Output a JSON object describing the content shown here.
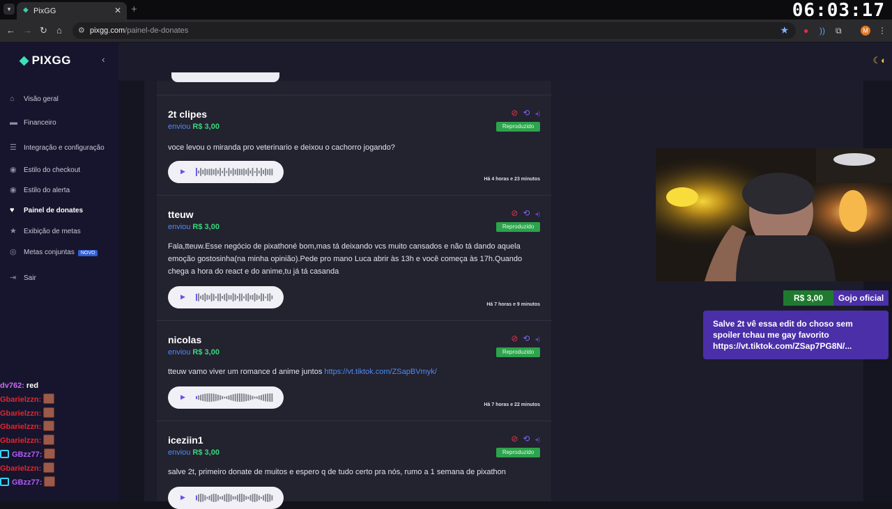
{
  "browser": {
    "tab_title": "PixGG",
    "url_host": "pixgg.com",
    "url_path": "/painel-de-donates",
    "profile_initial": "M"
  },
  "stream_clock": "06:03:17",
  "sidebar": {
    "logo": "PIXGG",
    "items": [
      {
        "label": "Visão geral",
        "icon": "home-icon"
      },
      {
        "label": "Financeiro",
        "icon": "wallet-icon"
      },
      {
        "label": "Integração e configuração",
        "icon": "settings-icon"
      },
      {
        "label": "Estilo do checkout",
        "icon": "palette-icon"
      },
      {
        "label": "Estilo do alerta",
        "icon": "palette-icon"
      },
      {
        "label": "Painel de donates",
        "icon": "donation-icon"
      },
      {
        "label": "Exibição de metas",
        "icon": "star-icon"
      },
      {
        "label": "Metas conjuntas",
        "icon": "target-icon"
      },
      {
        "label": "Sair",
        "icon": "logout-icon"
      }
    ],
    "new_badge": "NOVO"
  },
  "chat": [
    {
      "user": "dv762:",
      "text": "red",
      "color": "#c76bf5",
      "emote": false,
      "badge": false
    },
    {
      "user": "Gbarielzzn:",
      "text": "",
      "color": "#e0262f",
      "emote": true,
      "badge": false
    },
    {
      "user": "Gbarielzzn:",
      "text": "",
      "color": "#e0262f",
      "emote": true,
      "badge": false
    },
    {
      "user": "Gbarielzzn:",
      "text": "",
      "color": "#e0262f",
      "emote": true,
      "badge": false
    },
    {
      "user": "Gbarielzzn:",
      "text": "",
      "color": "#e0262f",
      "emote": true,
      "badge": false
    },
    {
      "user": "GBzz77:",
      "text": "",
      "color": "#b15cf5",
      "emote": true,
      "badge": true
    },
    {
      "user": "Gbarielzzn:",
      "text": "",
      "color": "#e0262f",
      "emote": true,
      "badge": false
    },
    {
      "user": "GBzz77:",
      "text": "",
      "color": "#b15cf5",
      "emote": true,
      "badge": true
    }
  ],
  "donations": {
    "sent_label": "enviou",
    "status_label": "Reproduzido",
    "items": [
      {
        "name": "2t clipes",
        "amount": "R$ 3,00",
        "message": "voce levou o miranda pro veterinario e deixou o cachorro jogando?",
        "link": "",
        "time": "Há 4 horas e 23 minutos"
      },
      {
        "name": "tteuw",
        "amount": "R$ 3,00",
        "message": "Fala,tteuw.Esse negócio de pixathoné bom,mas tá deixando vcs muito cansados e não tá dando aquela emoção gostosinha(na minha opinião).Pede pro mano Luca abrir às 13h e você começa às 17h.Quando chega a hora do react e do anime,tu já tá casanda",
        "link": "",
        "time": "Há 7 horas e 9 minutos"
      },
      {
        "name": "nicolas",
        "amount": "R$ 3,00",
        "message": "tteuw vamo viver um romance d anime juntos ",
        "link": "https://vt.tiktok.com/ZSapBVmyk/",
        "time": "Há 7 horas e 22 minutos"
      },
      {
        "name": "iceziin1",
        "amount": "R$ 3,00",
        "message": "salve 2t, primeiro donate de muitos e espero q de tudo certo pra nós, rumo a 1 semana de pixathon",
        "link": "",
        "time": ""
      }
    ]
  },
  "alert": {
    "amount": "R$ 3,00",
    "from": "Gojo oficial",
    "message": "Salve 2t vê essa edit do choso sem spoiler tchau me gay favorito https://vt.tiktok.com/ZSap7PG8N/..."
  },
  "colors": {
    "accent_green": "#38d97c",
    "accent_purple": "#4a2fa8",
    "sidebar_bg": "#17152d"
  }
}
